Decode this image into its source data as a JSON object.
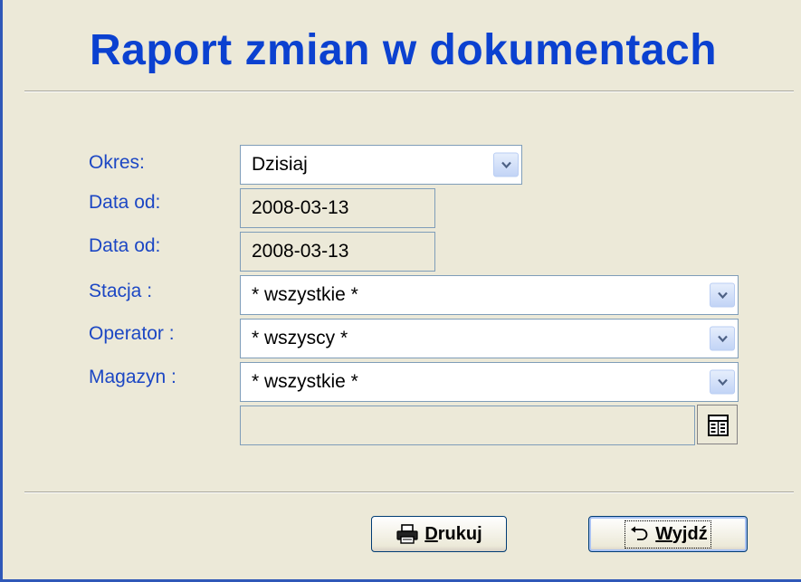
{
  "window": {
    "title": "Raport zmian w dokumentach"
  },
  "form": {
    "okres": {
      "label": "Okres:",
      "value": "Dzisiaj"
    },
    "date_from": {
      "label": "Data od:",
      "value": "2008-03-13"
    },
    "date_to": {
      "label": "Data od:",
      "value": "2008-03-13"
    },
    "stacja": {
      "label": "Stacja :",
      "value": "* wszystkie *"
    },
    "operator": {
      "label": "Operator :",
      "value": "* wszyscy *"
    },
    "magazyn": {
      "label": "Magazyn :",
      "value": "* wszystkie *"
    },
    "extra": {
      "value": ""
    }
  },
  "buttons": {
    "print": {
      "accel": "D",
      "rest": "rukuj"
    },
    "exit": {
      "accel": "W",
      "rest": "yjdź"
    }
  },
  "icons": {
    "dropdown": "chevron-down-icon",
    "lookup": "grid-lookup-icon",
    "print": "printer-icon",
    "exit": "undo-arrow-icon"
  }
}
